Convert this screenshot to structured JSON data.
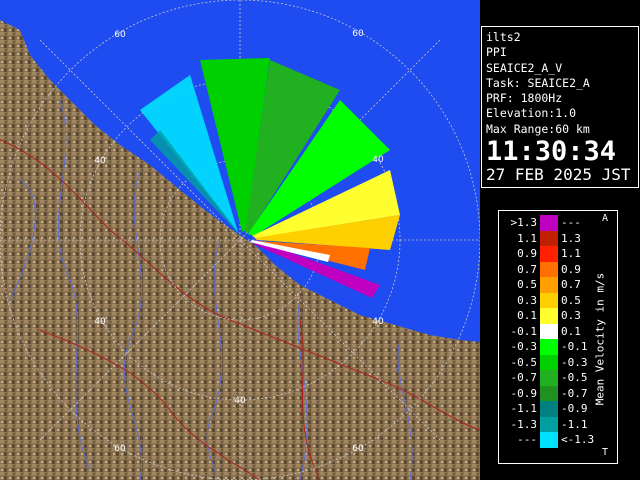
{
  "info": {
    "station": "ilts2",
    "scan_type": "PPI",
    "product": "SEAICE2_A_V",
    "task": "Task: SEAICE2_A",
    "prf": "PRF: 1800Hz",
    "elevation": "Elevation:1.0",
    "max_range": "Max Range:60 km",
    "time": "11:30:34",
    "date": "27 FEB 2025 JST"
  },
  "legend": {
    "title": "Mean Velocity in m/s",
    "rows": [
      {
        "lo": ">1.3",
        "hi": "---",
        "color": "#c000c0"
      },
      {
        "lo": "1.1",
        "hi": "1.3",
        "color": "#c02000"
      },
      {
        "lo": "0.9",
        "hi": "1.1",
        "color": "#ff2000"
      },
      {
        "lo": "0.7",
        "hi": "0.9",
        "color": "#ff7000"
      },
      {
        "lo": "0.5",
        "hi": "0.7",
        "color": "#ffa000"
      },
      {
        "lo": "0.3",
        "hi": "0.5",
        "color": "#ffd000"
      },
      {
        "lo": "0.1",
        "hi": "0.3",
        "color": "#ffff30"
      },
      {
        "lo": "-0.1",
        "hi": "0.1",
        "color": "#ffffff"
      },
      {
        "lo": "-0.3",
        "hi": "-0.1",
        "color": "#00ff00"
      },
      {
        "lo": "-0.5",
        "hi": "-0.3",
        "color": "#00d000"
      },
      {
        "lo": "-0.7",
        "hi": "-0.5",
        "color": "#20b020"
      },
      {
        "lo": "-0.9",
        "hi": "-0.7",
        "color": "#209020"
      },
      {
        "lo": "-1.1",
        "hi": "-0.9",
        "color": "#008080"
      },
      {
        "lo": "-1.3",
        "hi": "-1.1",
        "color": "#00a0a0"
      },
      {
        "lo": "---",
        "hi": "<-1.3",
        "color": "#00e0ff"
      }
    ]
  },
  "map": {
    "range_labels": [
      "60",
      "60",
      "40",
      "40",
      "40",
      "40",
      "40",
      "60",
      "60"
    ],
    "colors": {
      "sea": "#1e4cf0",
      "land": "#8b7352",
      "grid": "#c8c8c8",
      "rivers": "#5a6ee0",
      "boundaries": "#b02020"
    }
  }
}
